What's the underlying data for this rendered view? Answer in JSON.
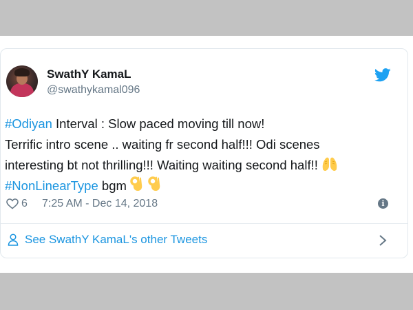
{
  "tweet": {
    "display_name": "SwathY KamaL",
    "handle": "@swathykamal096",
    "text": {
      "line1_hashtag": "#Odiyan",
      "line1_rest": " Interval : Slow paced moving till now!",
      "line2": "Terrific intro scene ..  waiting fr second half!!! Odi scenes",
      "line3": "interesting bt not thrilling!!! Waiting waiting second half!!",
      "line4_hashtag": "#NonLinearType",
      "line4_rest": " bgm"
    },
    "emojis": {
      "line3": "folded-hands-emoji",
      "line4": [
        "ok-hand-emoji",
        "ok-hand-emoji"
      ]
    },
    "likes": "6",
    "timestamp": "7:25 AM - Dec 14, 2018"
  },
  "footer": {
    "link_label": "See SwathY KamaL's other Tweets"
  },
  "icons": {
    "brand": "twitter-bird-icon",
    "like": "heart-icon",
    "info": "info-icon",
    "profile": "person-icon",
    "next": "chevron-right-icon"
  },
  "colors": {
    "accent": "#1b95e0",
    "text": "#14171a",
    "muted": "#657786",
    "band": "#c2c2c2",
    "emoji": "#ffcc4d"
  }
}
